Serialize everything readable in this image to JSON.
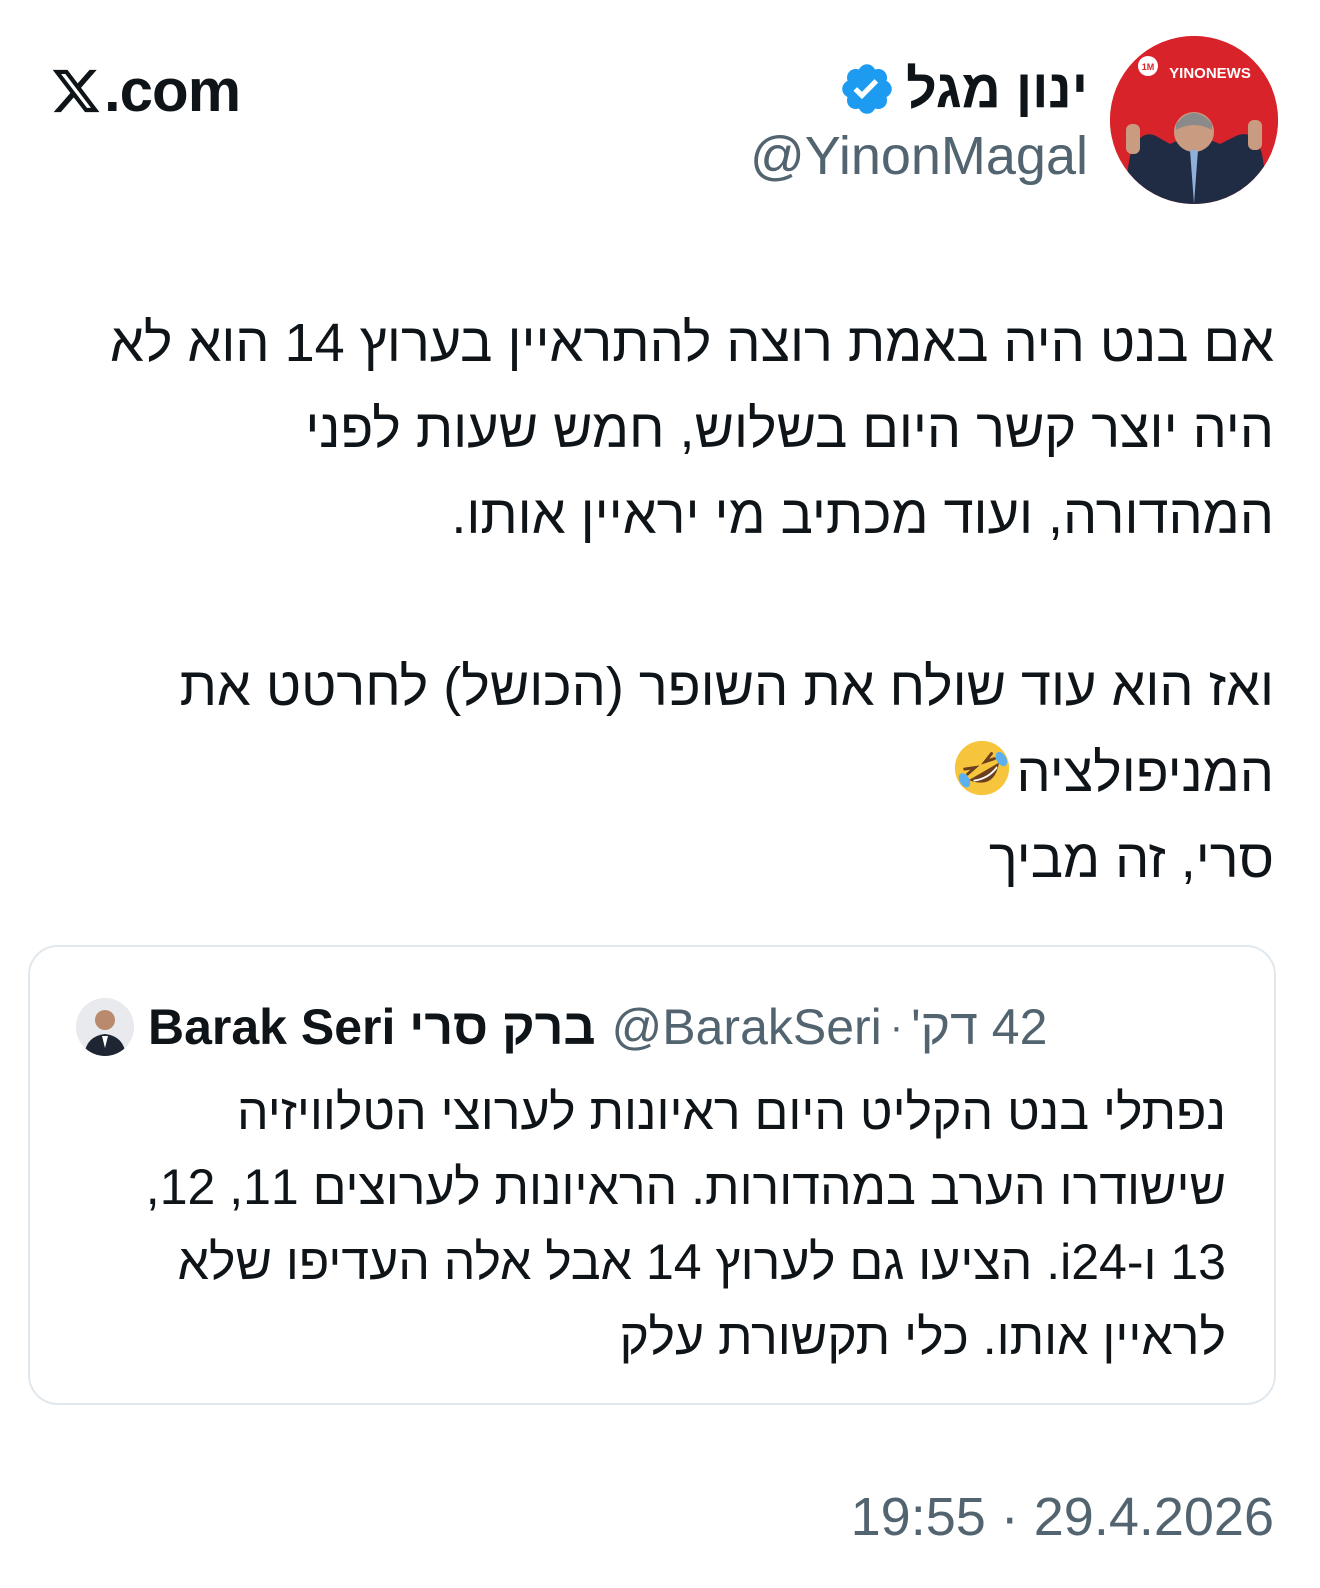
{
  "site": {
    "name": "X.com",
    "logo_icon": "x-logo-icon"
  },
  "author": {
    "display_name": "ינון מגל",
    "handle": "@YinonMagal",
    "verified": true,
    "verified_icon": "verified-badge-icon",
    "avatar_badge_text": "YINONEWS",
    "avatar_badge_small": "1M"
  },
  "tweet": {
    "text": "אם בנט היה באמת רוצה להתראיין בערוץ 14 הוא לא\nהיה יוצר קשר היום בשלוש, חמש שעות לפני\nהמהדורה,  ועוד מכתיב מי יראיין אותו.\n\nואז הוא עוד שולח את השופר (הכושל) לחרטט את\nהמניפולציה",
    "emoji": "rolling-on-floor-laughing-emoji",
    "text_tail": "סרי, זה מביך",
    "timestamp": "19:55 · 29.4.2026"
  },
  "quote": {
    "name": "Barak Seri ברק סרי",
    "handle": "@BarakSeri",
    "separator": "·",
    "time_ago": "42 דק'",
    "text": "נפתלי בנט הקליט היום ראיונות לערוצי הטלוויזיה\nשישודרו הערב במהדורות. הראיונות לערוצים 11, 12,\n13 ו-i24. הציעו גם לערוץ 14 אבל אלה העדיפו שלא\nלראיין אותו. כלי תקשורת עלק"
  },
  "colors": {
    "text": "#0f1419",
    "secondary": "#536471",
    "verified": "#1d9bf0",
    "border": "#e1e8ed",
    "avatar_bg": "#d9232b"
  }
}
